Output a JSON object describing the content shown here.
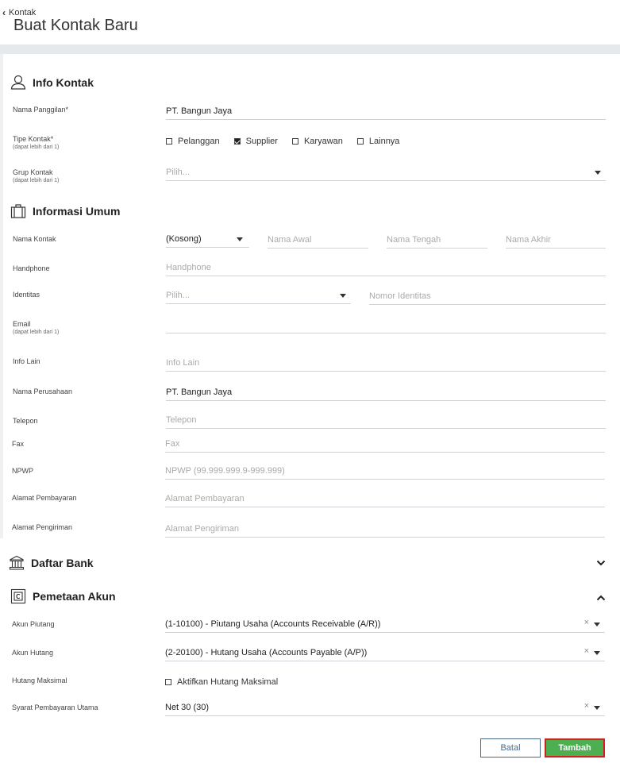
{
  "breadcrumb": {
    "parent": "Kontak"
  },
  "page_title": "Buat Kontak Baru",
  "sections": {
    "info_kontak": "Info Kontak",
    "informasi_umum": "Informasi Umum",
    "daftar_bank": "Daftar Bank",
    "pemetaan_akun": "Pemetaan Akun"
  },
  "info_kontak": {
    "nama_panggilan_label": "Nama Panggilan*",
    "nama_panggilan_value": "PT. Bangun Jaya",
    "tipe_label": "Tipe Kontak*",
    "tipe_sub": "(dapat lebih dari 1)",
    "tipe_options": [
      {
        "label": "Pelanggan",
        "checked": false
      },
      {
        "label": "Supplier",
        "checked": true
      },
      {
        "label": "Karyawan",
        "checked": false
      },
      {
        "label": "Lainnya",
        "checked": false
      }
    ],
    "grup_label": "Grup Kontak",
    "grup_sub": "(dapat lebih dari 1)",
    "grup_placeholder": "Pilih..."
  },
  "informasi_umum": {
    "nama_kontak_label": "Nama Kontak",
    "salutation_value": "(Kosong)",
    "nama_awal_ph": "Nama Awal",
    "nama_tengah_ph": "Nama Tengah",
    "nama_akhir_ph": "Nama Akhir",
    "handphone_label": "Handphone",
    "handphone_ph": "Handphone",
    "identitas_label": "Identitas",
    "identitas_ph": "Pilih...",
    "nomor_identitas_ph": "Nomor Identitas",
    "email_label": "Email",
    "email_sub": "(dapat lebih dari 1)",
    "info_lain_label": "Info Lain",
    "info_lain_ph": "Info Lain",
    "perusahaan_label": "Nama Perusahaan",
    "perusahaan_value": "PT. Bangun Jaya",
    "telepon_label": "Telepon",
    "telepon_ph": "Telepon",
    "fax_label": "Fax",
    "fax_ph": "Fax",
    "npwp_label": "NPWP",
    "npwp_ph": "NPWP (99.999.999.9-999.999)",
    "alamat_bayar_label": "Alamat Pembayaran",
    "alamat_bayar_ph": "Alamat Pembayaran",
    "alamat_kirim_label": "Alamat Pengiriman",
    "alamat_kirim_ph": "Alamat Pengiriman"
  },
  "pemetaan_akun": {
    "piutang_label": "Akun Piutang",
    "piutang_value": "(1-10100) - Piutang Usaha (Accounts Receivable (A/R))",
    "hutang_label": "Akun Hutang",
    "hutang_value": "(2-20100) - Hutang Usaha (Accounts Payable (A/P))",
    "hutang_max_label": "Hutang Maksimal",
    "hutang_max_check": "Aktifkan Hutang Maksimal",
    "syarat_label": "Syarat Pembayaran Utama",
    "syarat_value": "Net 30 (30)"
  },
  "icons": {
    "clear": "×"
  },
  "actions": {
    "cancel": "Batal",
    "submit": "Tambah"
  },
  "colors": {
    "submit_bg": "#4caf50",
    "cancel_border": "#4a6a85",
    "highlight": "#d41f1f"
  }
}
